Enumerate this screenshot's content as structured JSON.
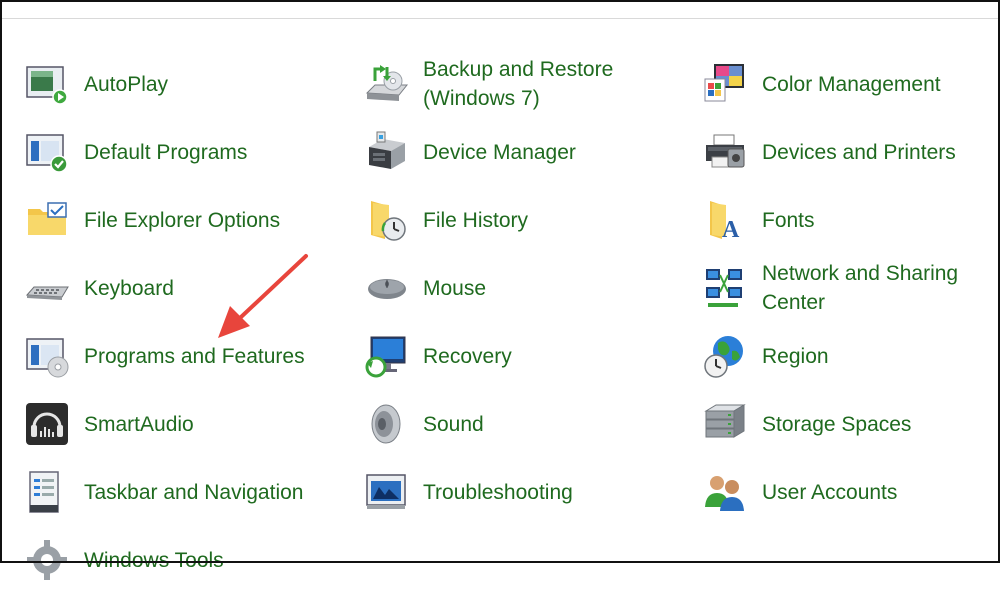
{
  "control_panel": {
    "items": [
      {
        "label": "AutoPlay",
        "icon": "autoplay-icon"
      },
      {
        "label": "Backup and Restore\n(Windows 7)",
        "icon": "backup-restore-icon"
      },
      {
        "label": "Color Management",
        "icon": "color-management-icon"
      },
      {
        "label": "Default Programs",
        "icon": "default-programs-icon"
      },
      {
        "label": "Device Manager",
        "icon": "device-manager-icon"
      },
      {
        "label": "Devices and Printers",
        "icon": "printer-icon"
      },
      {
        "label": "File Explorer Options",
        "icon": "folder-options-icon"
      },
      {
        "label": "File History",
        "icon": "file-history-icon"
      },
      {
        "label": "Fonts",
        "icon": "fonts-icon"
      },
      {
        "label": "Keyboard",
        "icon": "keyboard-icon"
      },
      {
        "label": "Mouse",
        "icon": "mouse-icon"
      },
      {
        "label": "Network and Sharing\nCenter",
        "icon": "network-icon"
      },
      {
        "label": "Programs and Features",
        "icon": "programs-features-icon"
      },
      {
        "label": "Recovery",
        "icon": "recovery-icon"
      },
      {
        "label": "Region",
        "icon": "globe-clock-icon"
      },
      {
        "label": "SmartAudio",
        "icon": "headphones-icon"
      },
      {
        "label": "Sound",
        "icon": "speaker-icon"
      },
      {
        "label": "Storage Spaces",
        "icon": "storage-spaces-icon"
      },
      {
        "label": "Taskbar and Navigation",
        "icon": "taskbar-icon"
      },
      {
        "label": "Troubleshooting",
        "icon": "troubleshooting-icon"
      },
      {
        "label": "User Accounts",
        "icon": "user-accounts-icon"
      },
      {
        "label": "Windows Tools",
        "icon": "gear-icon"
      }
    ]
  },
  "colors": {
    "link_green": "#1f6a1f",
    "arrow_red": "#e8453c"
  }
}
